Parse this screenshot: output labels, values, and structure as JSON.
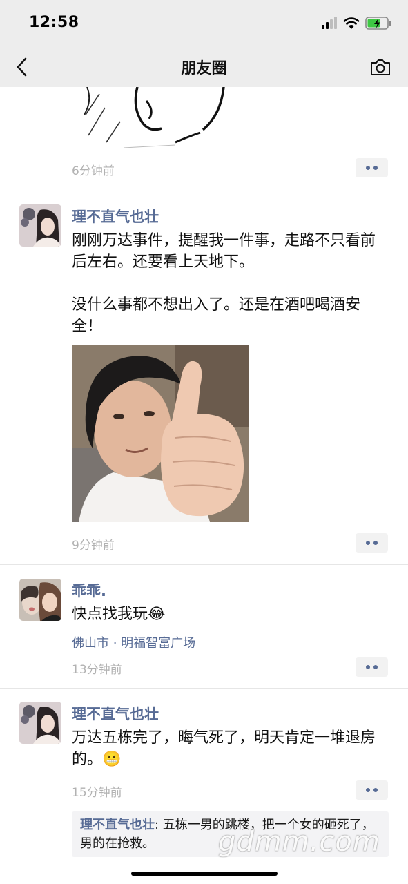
{
  "status": {
    "time": "12:58"
  },
  "nav": {
    "title": "朋友圈"
  },
  "feed": {
    "top_post": {
      "time": "6分钟前"
    },
    "post1": {
      "author": "理不直气也壮",
      "text": "刚刚万达事件，提醒我一件事，走路不只看前后左右。还要看上天地下。\n\n没什么事都不想出入了。还是在酒吧喝酒安全！",
      "time": "9分钟前"
    },
    "post2": {
      "author": "乖乖.",
      "text": "快点找我玩😂",
      "location": "佛山市 · 明福智富广场",
      "time": "13分钟前"
    },
    "post3": {
      "author": "理不直气也壮",
      "text": "万达五栋完了，晦气死了，明天肯定一堆退房的。😬",
      "time": "15分钟前",
      "comment_author": "理不直气也壮",
      "comment_sep": ": ",
      "comment_text": "五栋一男的跳楼，把一个女的砸死了，男的在抢救。"
    }
  },
  "watermark": "gdmm.com",
  "colors": {
    "link": "#576b95",
    "bar": "#ededed",
    "time": "#b2b2b2"
  },
  "icons": [
    "chevron-left-icon",
    "camera-icon",
    "signal-icon",
    "wifi-icon",
    "battery-icon",
    "more-dots-icon"
  ]
}
